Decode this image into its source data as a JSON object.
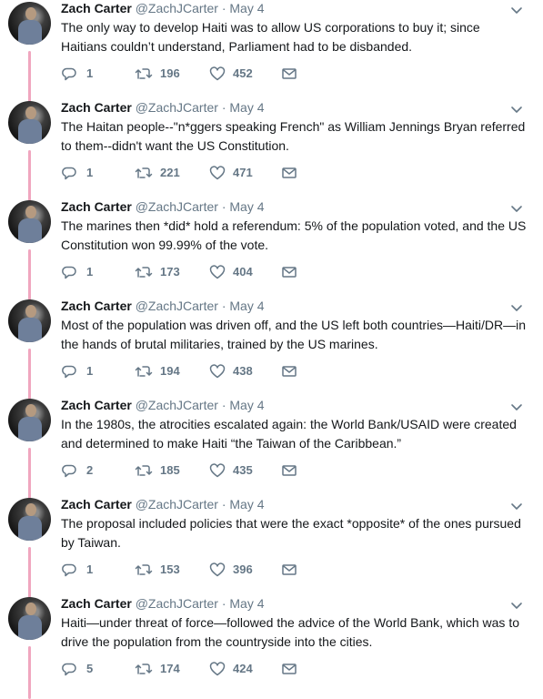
{
  "feed": {
    "tweets": [
      {
        "name": "Zach Carter",
        "handle": "@ZachJCarter",
        "sep": "·",
        "date": "May 4",
        "text": "The only way to develop Haiti was to allow US corporations to buy it; since Haitians couldn’t understand, Parliament had to be disbanded.",
        "replies": "1",
        "retweets": "196",
        "likes": "452"
      },
      {
        "name": "Zach Carter",
        "handle": "@ZachJCarter",
        "sep": "·",
        "date": "May 4",
        "text": "The Haitan people--\"n*ggers speaking French\" as William Jennings Bryan referred to them--didn't want the US Constitution.",
        "replies": "1",
        "retweets": "221",
        "likes": "471"
      },
      {
        "name": "Zach Carter",
        "handle": "@ZachJCarter",
        "sep": "·",
        "date": "May 4",
        "text": "The marines then *did* hold a referendum: 5% of the population voted, and the US Constitution won 99.99% of the vote.",
        "replies": "1",
        "retweets": "173",
        "likes": "404"
      },
      {
        "name": "Zach Carter",
        "handle": "@ZachJCarter",
        "sep": "·",
        "date": "May 4",
        "text": "Most of the population was driven off, and the US left both countries—Haiti/DR—in the hands of brutal militaries, trained by the US marines.",
        "replies": "1",
        "retweets": "194",
        "likes": "438"
      },
      {
        "name": "Zach Carter",
        "handle": "@ZachJCarter",
        "sep": "·",
        "date": "May 4",
        "text": "In the 1980s, the atrocities escalated again: the World Bank/USAID were created and determined to make Haiti “the Taiwan of the Caribbean.”",
        "replies": "2",
        "retweets": "185",
        "likes": "435"
      },
      {
        "name": "Zach Carter",
        "handle": "@ZachJCarter",
        "sep": "·",
        "date": "May 4",
        "text": "The proposal included policies that were the exact *opposite* of the ones pursued by Taiwan.",
        "replies": "1",
        "retweets": "153",
        "likes": "396"
      },
      {
        "name": "Zach Carter",
        "handle": "@ZachJCarter",
        "sep": "·",
        "date": "May 4",
        "text": "Haiti—under threat of force—followed the advice of the World Bank, which was to drive the population from the countryside into the cities.",
        "replies": "5",
        "retweets": "174",
        "likes": "424"
      }
    ],
    "colors": {
      "thread_line": "#f0a6bf",
      "meta_gray": "#657786",
      "text": "#14171a"
    },
    "icons": {
      "reply": "reply-icon",
      "retweet": "retweet-icon",
      "like": "heart-icon",
      "dm": "envelope-icon",
      "menu": "chevron-down-icon"
    }
  }
}
